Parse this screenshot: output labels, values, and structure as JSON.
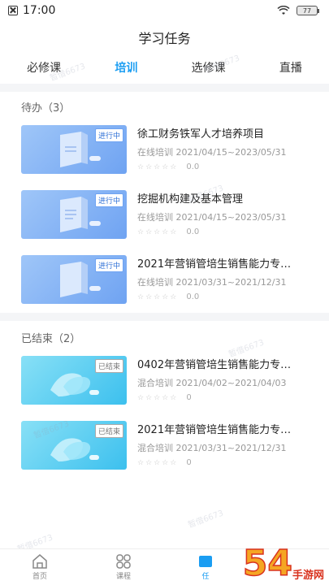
{
  "status_bar": {
    "time": "17:00",
    "battery": "77"
  },
  "header": {
    "title": "学习任务"
  },
  "tabs": [
    {
      "label": "必修课",
      "active": false
    },
    {
      "label": "培训",
      "active": true
    },
    {
      "label": "选修课",
      "active": false
    },
    {
      "label": "直播",
      "active": false
    }
  ],
  "sections": {
    "pending": {
      "title": "待办（3）",
      "items": [
        {
          "tag": "进行中",
          "title": "徐工财务铁军人才培养项目",
          "meta": "在线培训 2021/04/15~2023/05/31",
          "stars": "☆☆☆☆☆",
          "score": "0.0"
        },
        {
          "tag": "进行中",
          "title": "挖掘机构建及基本管理",
          "meta": "在线培训 2021/04/15~2023/05/31",
          "stars": "☆☆☆☆☆",
          "score": "0.0"
        },
        {
          "tag": "进行中",
          "title": "2021年营销管培生销售能力专…",
          "meta": "在线培训 2021/03/31~2021/12/31",
          "stars": "☆☆☆☆☆",
          "score": "0.0"
        }
      ]
    },
    "ended": {
      "title": "已结束（2）",
      "items": [
        {
          "tag": "已结束",
          "title": "0402年营销管培生销售能力专…",
          "meta": "混合培训 2021/04/02~2021/04/03",
          "stars": "☆☆☆☆☆",
          "score": "0"
        },
        {
          "tag": "已结束",
          "title": "2021年营销管培生销售能力专…",
          "meta": "混合培训 2021/03/31~2021/12/31",
          "stars": "☆☆☆☆☆",
          "score": "0"
        }
      ]
    }
  },
  "bottom_nav": [
    {
      "label": "首页",
      "icon": "home-icon"
    },
    {
      "label": "课程",
      "icon": "grid-icon"
    },
    {
      "label": "任",
      "icon": "task-icon"
    }
  ],
  "watermark": "暂借6673",
  "corner_logo": {
    "number": "54",
    "text": "手游网"
  },
  "colors": {
    "accent": "#1a9df2",
    "ongoing_thumb": "#6fa3f2",
    "ended_thumb": "#3cc0ee"
  }
}
